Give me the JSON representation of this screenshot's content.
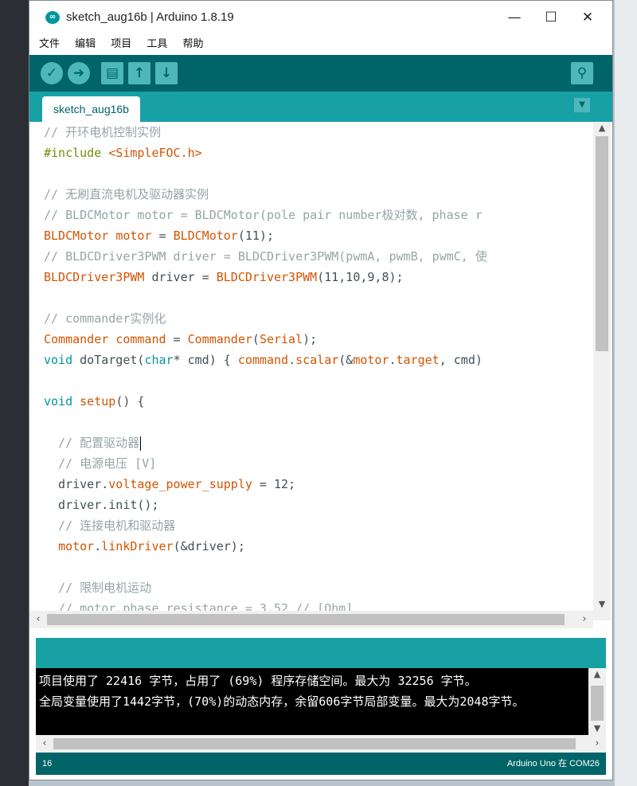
{
  "window": {
    "title": "sketch_aug16b | Arduino 1.8.19"
  },
  "menubar": {
    "items": [
      "文件",
      "编辑",
      "项目",
      "工具",
      "帮助"
    ]
  },
  "toolbar": {
    "verify": "✓",
    "upload": "➜",
    "new": "▤",
    "open": "↑",
    "save": "↓",
    "serial_monitor": "⚲"
  },
  "tabs": [
    {
      "label": "sketch_aug16b"
    }
  ],
  "editor": {
    "lines": [
      "// 开环电机控制实例",
      "#include <SimpleFOC.h>",
      "",
      "// 无刷直流电机及驱动器实例",
      "// BLDCMotor motor = BLDCMotor(pole pair number极对数, phase r",
      "BLDCMotor motor = BLDCMotor(11);",
      "// BLDCDriver3PWM driver = BLDCDriver3PWM(pwmA, pwmB, pwmC, 使",
      "BLDCDriver3PWM driver = BLDCDriver3PWM(11,10,9,8);",
      "",
      "// commander实例化",
      "Commander command = Commander(Serial);",
      "void doTarget(char* cmd) { command.scalar(&motor.target, cmd)",
      "",
      "void setup() {",
      "",
      "  // 配置驱动器",
      "  // 电源电压 [V]",
      "  driver.voltage_power_supply = 12;",
      "  driver.init();",
      "  // 连接电机和驱动器",
      "  motor.linkDriver(&driver);",
      "",
      "  // 限制电机运动",
      "  // motor.phase_resistance = 3.52 // [Ohm]"
    ]
  },
  "console": {
    "lines": [
      "项目使用了 22416 字节，占用了 (69%) 程序存储空间。最大为 32256 字节。",
      "全局变量使用了1442字节，(70%)的动态内存，余留606字节局部变量。最大为2048字节。"
    ]
  },
  "statusbar": {
    "line": "16",
    "board": "Arduino Uno 在 COM26"
  },
  "colors": {
    "teal_dark": "#006468",
    "teal_mid": "#17a1a5",
    "teal_light": "#4db7bb",
    "keyword": "#00979c",
    "type": "#d35400",
    "comment": "#95a5a6"
  }
}
